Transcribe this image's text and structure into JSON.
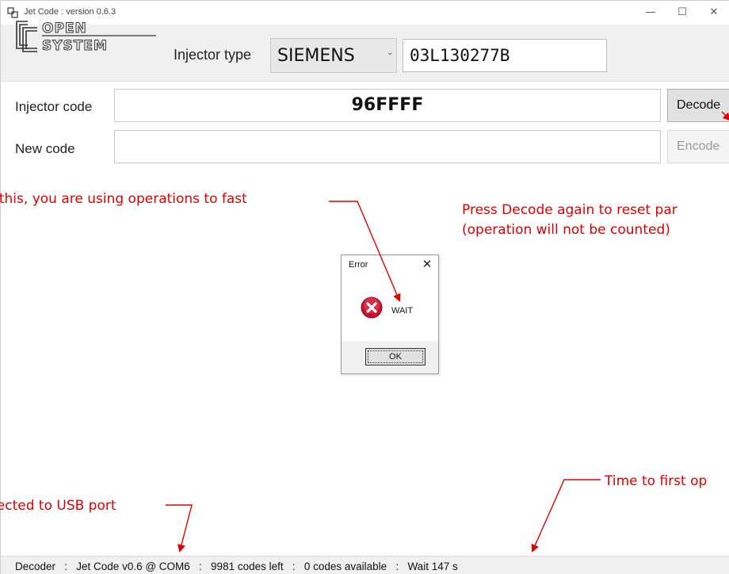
{
  "window": {
    "title": "Jet Code : version 0.6.3",
    "controls": {
      "minimize": "—",
      "maximize": "☐",
      "close": "✕"
    }
  },
  "logo": {
    "line1": "OPEN",
    "line2": "SYSTEM"
  },
  "header": {
    "injector_type_label": "Injector type",
    "injector_type_value": "SIEMENS",
    "part_number": "03L130277B"
  },
  "codes": {
    "injector_code_label": "Injector code",
    "injector_code_value": "96FFFF",
    "new_code_label": "New code",
    "new_code_value": "",
    "decode_label": "Decode",
    "encode_label": "Encode"
  },
  "annotations": {
    "too_fast": "e this, you are using operations to fast",
    "decode_again_line1": "Press Decode again to reset par",
    "decode_again_line2": "(operation will not be counted)",
    "usb": "nected to USB port",
    "time_first": "Time to first op"
  },
  "dialog": {
    "title": "Error",
    "close": "✕",
    "message": "WAIT",
    "ok_label": "OK"
  },
  "status_bar": {
    "text": "Decoder   :   Jet Code v0.6 @ COM6   :   9981 codes left   :   0 codes available   :   Wait 147 s"
  },
  "colors": {
    "annotation": "#e00000",
    "header_band": "#f0f0f0",
    "status_bar": "#f0f0f0",
    "error_icon": "#c8102e"
  }
}
